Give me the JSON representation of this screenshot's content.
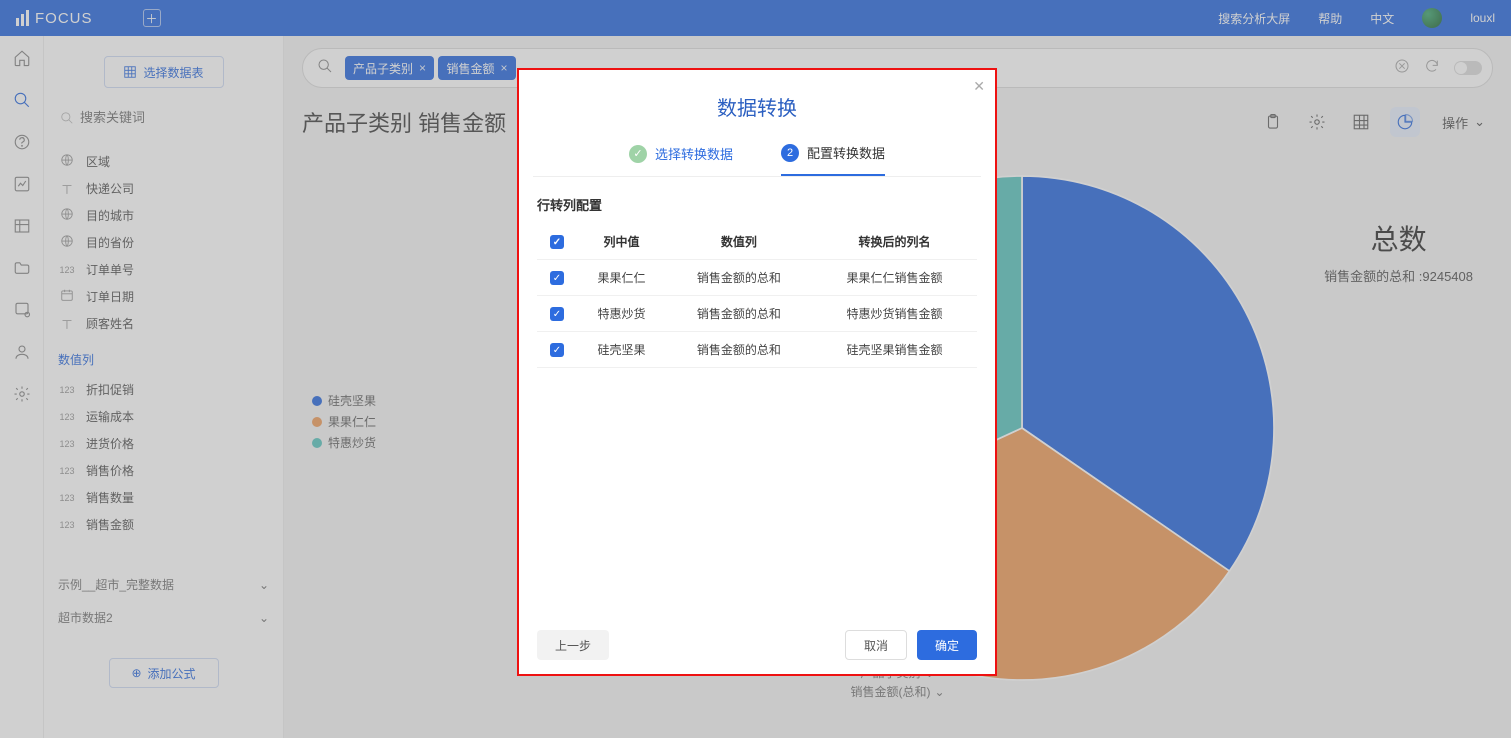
{
  "app": {
    "name": "FOCUS"
  },
  "header": {
    "links": {
      "dashboard": "搜索分析大屏",
      "help": "帮助",
      "lang": "中文"
    },
    "user": "louxl"
  },
  "sidepanel": {
    "select_table_btn": "选择数据表",
    "search_placeholder": "搜索关键词",
    "attr_fields": [
      {
        "ico": "globe",
        "label": "区域"
      },
      {
        "ico": "text",
        "label": "快递公司"
      },
      {
        "ico": "globe",
        "label": "目的城市"
      },
      {
        "ico": "globe",
        "label": "目的省份"
      },
      {
        "ico": "num",
        "label": "订单单号"
      },
      {
        "ico": "date",
        "label": "订单日期"
      },
      {
        "ico": "text",
        "label": "顾客姓名"
      }
    ],
    "num_section": "数值列",
    "num_fields": [
      {
        "ico": "num",
        "label": "折扣促销"
      },
      {
        "ico": "num",
        "label": "运输成本"
      },
      {
        "ico": "num",
        "label": "进货价格"
      },
      {
        "ico": "num",
        "label": "销售价格"
      },
      {
        "ico": "num",
        "label": "销售数量"
      },
      {
        "ico": "num",
        "label": "销售金额"
      }
    ],
    "datasets": [
      {
        "label": "示例__超市_完整数据"
      },
      {
        "label": "超市数据2"
      }
    ],
    "add_formula": "添加公式"
  },
  "query": {
    "chips": [
      "产品子类别",
      "销售金额"
    ]
  },
  "page": {
    "title": "产品子类别 销售金额",
    "operate": "操作"
  },
  "legend": [
    {
      "color": "#2d6cdf",
      "label": "硅壳坚果"
    },
    {
      "color": "#f0a060",
      "label": "果果仁仁"
    },
    {
      "color": "#5fc6c0",
      "label": "特惠炒货"
    }
  ],
  "stats": {
    "title": "总数",
    "line": "销售金额的总和 :9245408"
  },
  "axis": {
    "cat": "产品子类别",
    "val": "销售金额(总和)"
  },
  "modal": {
    "title": "数据转换",
    "step1": "选择转换数据",
    "step2": "配置转换数据",
    "section": "行转列配置",
    "headers": {
      "col": "列中值",
      "val": "数值列",
      "out": "转换后的列名"
    },
    "rows": [
      {
        "col": "果果仁仁",
        "val": "销售金额的总和",
        "out": "果果仁仁销售金额"
      },
      {
        "col": "特惠炒货",
        "val": "销售金额的总和",
        "out": "特惠炒货销售金额"
      },
      {
        "col": "硅壳坚果",
        "val": "销售金额的总和",
        "out": "硅壳坚果销售金额"
      }
    ],
    "btn_prev": "上一步",
    "btn_cancel": "取消",
    "btn_ok": "确定"
  },
  "chart_data": {
    "type": "pie",
    "title": "产品子类别 销售金额",
    "series": [
      {
        "name": "硅壳坚果",
        "value": 3200000,
        "color": "#2d6cdf"
      },
      {
        "name": "果果仁仁",
        "value": 3100000,
        "color": "#f0a060"
      },
      {
        "name": "特惠炒货",
        "value": 2945408,
        "color": "#5fc6c0"
      }
    ],
    "total_label": "销售金额的总和",
    "total_value": 9245408
  }
}
